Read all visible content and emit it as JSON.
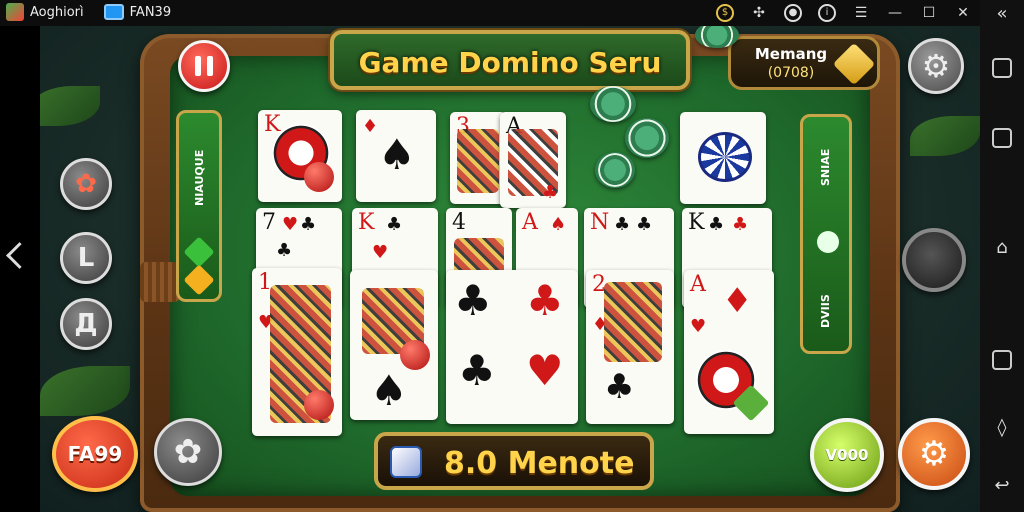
{
  "statusbar": {
    "app_name": "Aoghiorì",
    "window_title": "FAN39",
    "icons": [
      "coin-icon",
      "pinwheel-icon",
      "target-icon",
      "info-icon",
      "menu-icon",
      "minimize-icon",
      "maximize-icon",
      "close-icon",
      "collapse-icon"
    ]
  },
  "header": {
    "title": "Game Domino Seru",
    "win_label": "Memang",
    "win_value": "(0708)"
  },
  "side_panels": {
    "left_label": "NIAUQUE",
    "right_top_label": "SNIAE",
    "right_bottom_label": "DVIIS"
  },
  "buttons": {
    "brand": "FA99",
    "go": "V000",
    "side_2": "L",
    "side_3": "Д"
  },
  "score": {
    "text": "8.0 Menote"
  },
  "cards": {
    "row1": [
      {
        "rank": "K",
        "suit": "♥"
      },
      {
        "rank": "",
        "suit": "♠"
      },
      {
        "rank": "3",
        "suit": "♦"
      },
      {
        "rank": "A",
        "suit": "♣"
      },
      {
        "rank": "",
        "suit": ""
      }
    ],
    "row2": [
      {
        "rank": "7",
        "suit": "♣"
      },
      {
        "rank": "K",
        "suit": "♣"
      },
      {
        "rank": "4",
        "suit": "♠"
      },
      {
        "rank": "A",
        "suit": "♠"
      },
      {
        "rank": "N",
        "suit": "♣"
      },
      {
        "rank": "K",
        "suit": "♣"
      }
    ],
    "row3": [
      {
        "rank": "1",
        "suit": "♥"
      },
      {
        "rank": "",
        "suit": ""
      },
      {
        "rank": "",
        "suit": "♣"
      },
      {
        "rank": "2",
        "suit": "♦"
      },
      {
        "rank": "A",
        "suit": "♦"
      }
    ]
  },
  "colors": {
    "felt": "#1f6a2c",
    "gold": "#c9a64a",
    "title_text": "#ffd34a"
  }
}
